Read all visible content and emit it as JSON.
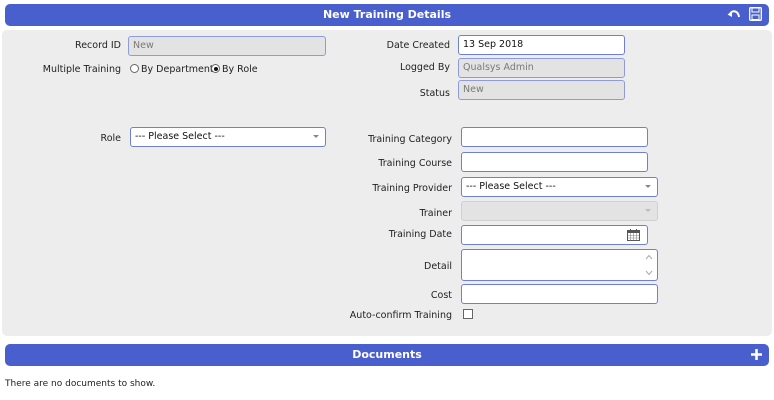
{
  "header": {
    "title": "New Training Details"
  },
  "form": {
    "record_id": {
      "label": "Record ID",
      "value": "New"
    },
    "multiple_training": {
      "label": "Multiple Training",
      "options": [
        "By Department",
        "By Role"
      ],
      "selected": "By Role"
    },
    "date_created": {
      "label": "Date Created",
      "value": "13 Sep 2018"
    },
    "logged_by": {
      "label": "Logged By",
      "value": "Qualsys Admin"
    },
    "status": {
      "label": "Status",
      "value": "New"
    },
    "role": {
      "label": "Role",
      "value": "--- Please Select ---"
    },
    "training_category": {
      "label": "Training Category",
      "value": ""
    },
    "training_course": {
      "label": "Training Course",
      "value": ""
    },
    "training_provider": {
      "label": "Training Provider",
      "value": "--- Please Select ---"
    },
    "trainer": {
      "label": "Trainer",
      "value": ""
    },
    "training_date": {
      "label": "Training Date",
      "value": ""
    },
    "detail": {
      "label": "Detail",
      "value": ""
    },
    "cost": {
      "label": "Cost",
      "value": ""
    },
    "auto_confirm": {
      "label": "Auto-confirm Training",
      "checked": false
    }
  },
  "documents": {
    "title": "Documents",
    "empty_message": "There are no documents to show."
  },
  "icons": {
    "undo": "undo-icon",
    "save": "save-icon",
    "add": "plus-icon",
    "calendar": "calendar-icon"
  },
  "colors": {
    "accent": "#4a5fce",
    "panel": "#ededed",
    "field_border": "#6f7fd6"
  }
}
